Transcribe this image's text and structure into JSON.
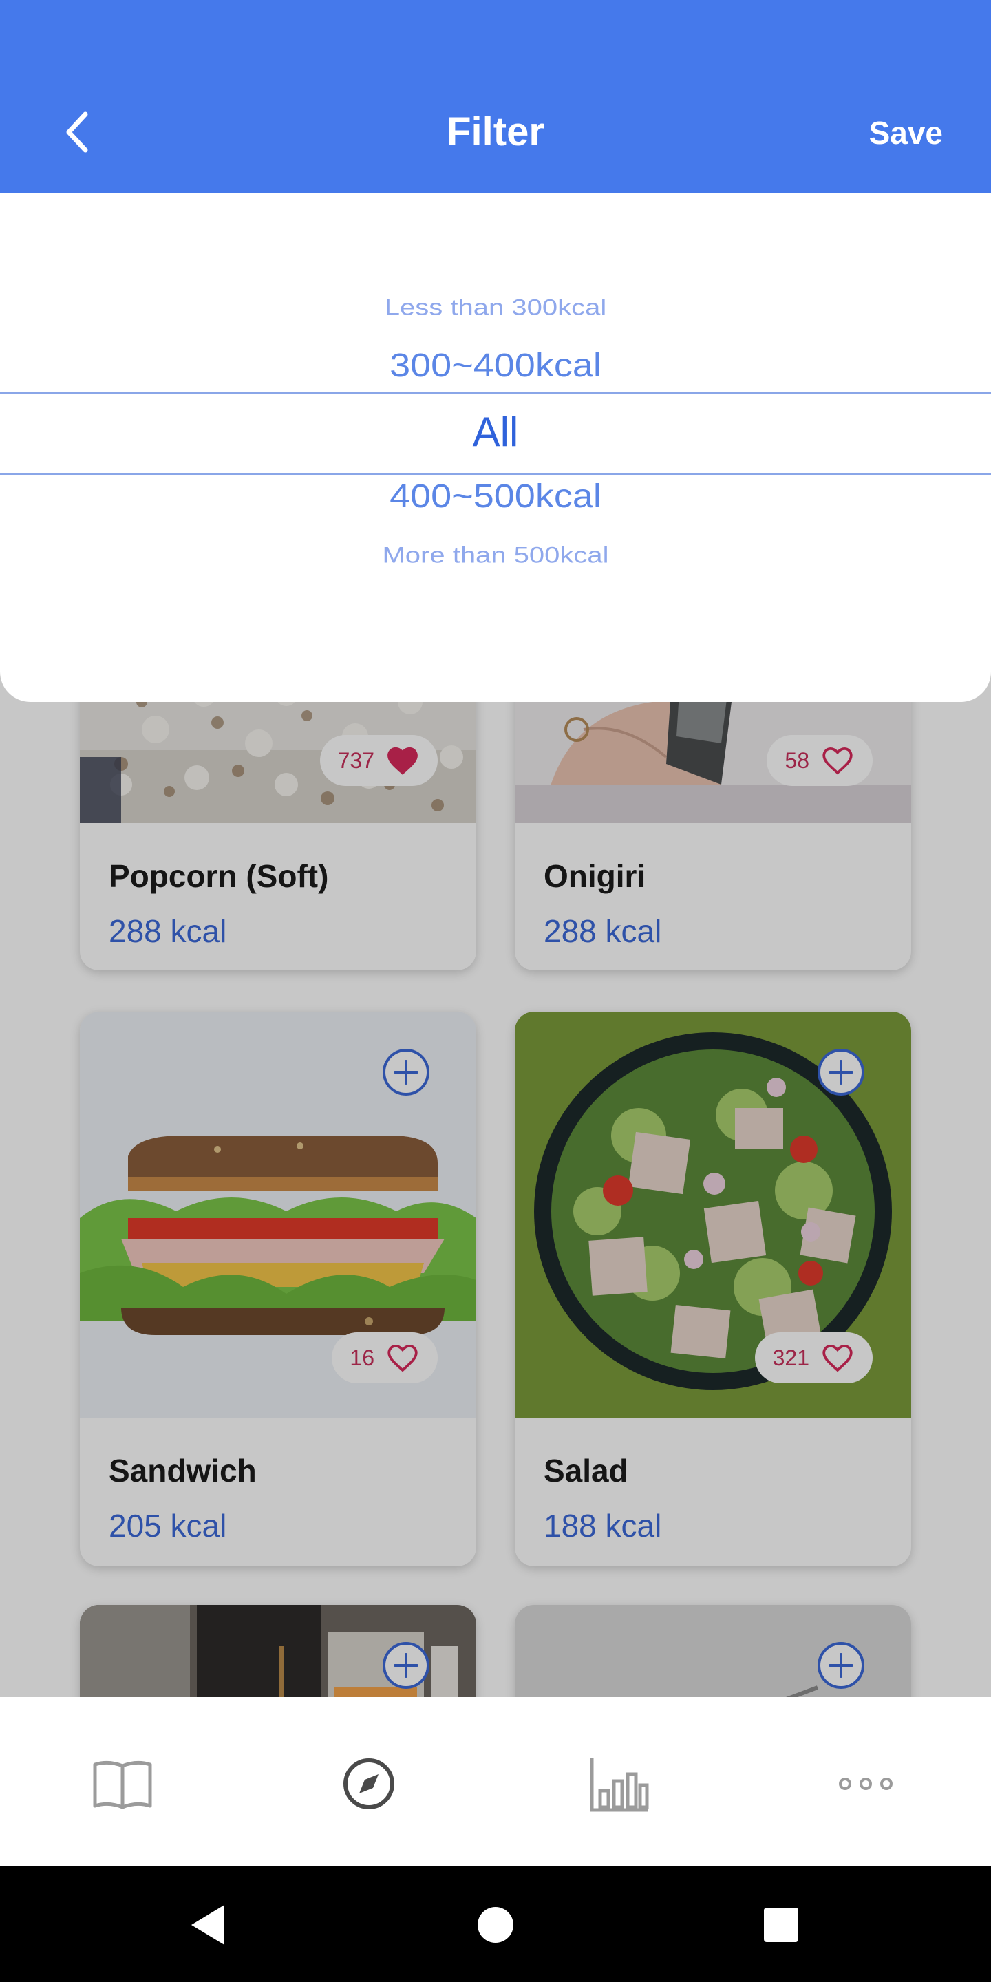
{
  "header": {
    "title": "Filter",
    "save_label": "Save",
    "back_icon": "chevron-left-icon",
    "bg_color": "#4579eb"
  },
  "picker": {
    "options": [
      "Less than 300kcal",
      "300~400kcal",
      "All",
      "400~500kcal",
      "More than 500kcal"
    ],
    "selected": "All",
    "accent_color": "#2f62db"
  },
  "foods": [
    {
      "name": "Popcorn (Soft)",
      "kcal": "288 kcal",
      "likes": "737",
      "liked": true
    },
    {
      "name": "Onigiri",
      "kcal": "288 kcal",
      "likes": "58",
      "liked": false
    },
    {
      "name": "Sandwich",
      "kcal": "205 kcal",
      "likes": "16",
      "liked": false
    },
    {
      "name": "Salad",
      "kcal": "188 kcal",
      "likes": "321",
      "liked": false
    }
  ],
  "bottom_nav": {
    "items": [
      "book-icon",
      "compass-icon",
      "bar-chart-icon",
      "more-icon"
    ],
    "active": "compass-icon"
  },
  "system_nav": [
    "back-triangle-icon",
    "home-circle-icon",
    "recents-square-icon"
  ],
  "colors": {
    "kcal": "#3c68d8",
    "heart": "#d82a5c",
    "dim_overlay": "rgba(0,0,0,0.22)"
  }
}
